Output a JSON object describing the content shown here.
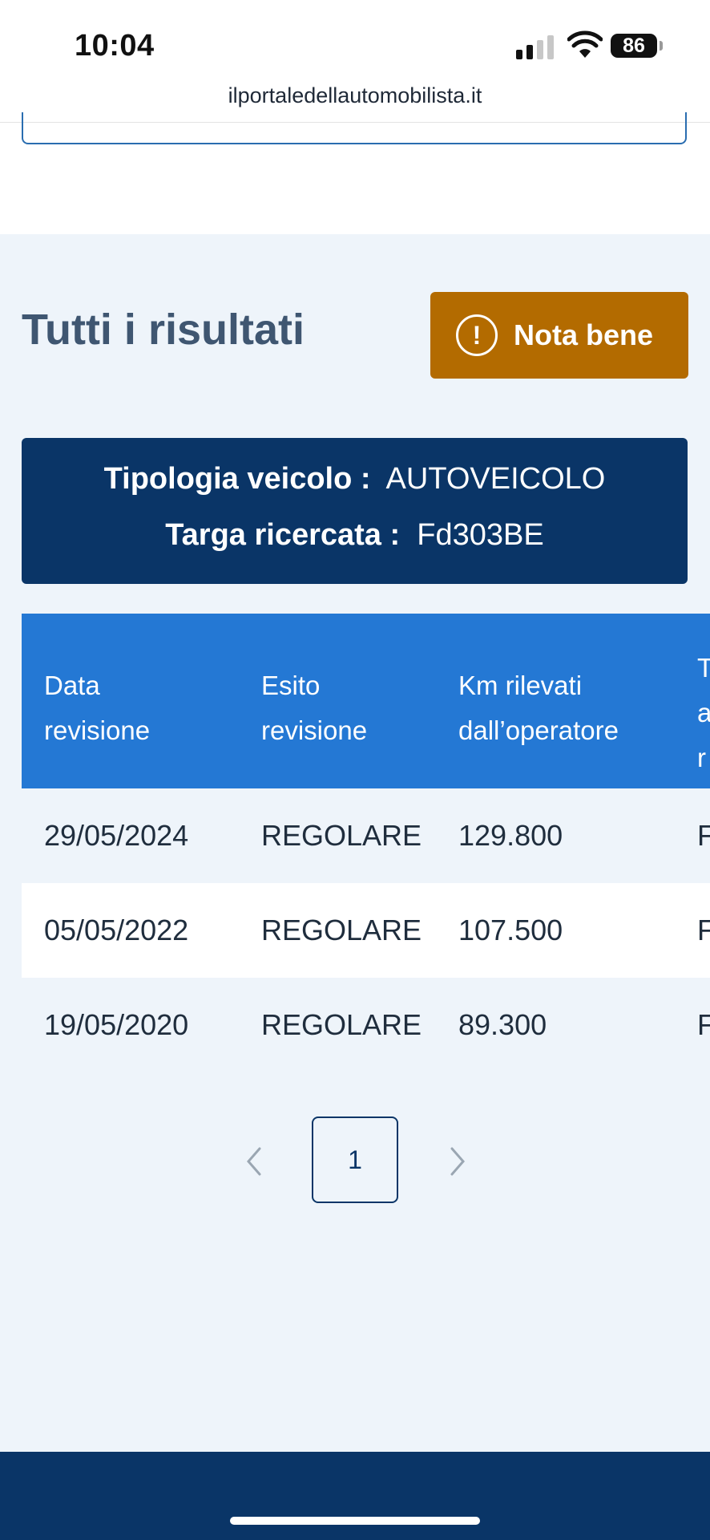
{
  "status_bar": {
    "time": "10:04",
    "battery": "86",
    "url": "ilportaledellautomobilista.it"
  },
  "main": {
    "title": "Tutti i risultati",
    "nota_bene": {
      "icon": "exclamation-circle-icon",
      "icon_glyph": "!",
      "label": "Nota bene",
      "color": "#b36b00"
    }
  },
  "vehicle_info": {
    "type_label": "Tipologia veicolo :",
    "type_value": "AUTOVEICOLO",
    "plate_label": "Targa ricercata :",
    "plate_value": "Fd303BE"
  },
  "table": {
    "headers": [
      "Data revisione",
      "Esito revisione",
      "Km rilevati dall’operatore",
      "T a r"
    ],
    "header_lines": [
      [
        "Data",
        "revisione"
      ],
      [
        "Esito",
        "revisione"
      ],
      [
        "Km rilevati",
        "dall’operatore"
      ],
      [
        "T",
        "a",
        "r"
      ]
    ],
    "rows": [
      [
        "29/05/2024",
        "REGOLARE",
        "129.800",
        "F"
      ],
      [
        "05/05/2022",
        "REGOLARE",
        "107.500",
        "F"
      ],
      [
        "19/05/2020",
        "REGOLARE",
        "89.300",
        "F"
      ]
    ]
  },
  "pagination": {
    "current_page": "1",
    "prev_icon": "chevron-left-icon",
    "next_icon": "chevron-right-icon"
  },
  "colors": {
    "header_blue": "#2478d4",
    "navy": "#0a3567",
    "content_bg": "#eef4fa"
  }
}
